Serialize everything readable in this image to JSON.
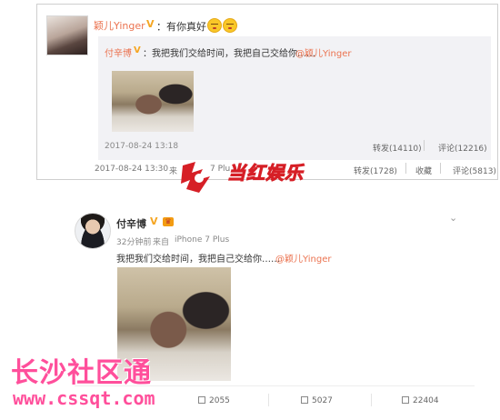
{
  "top_post": {
    "author": "颖儿Yinger",
    "verified_badge": "V",
    "text": "：有你真好",
    "emoji_icons": [
      "smiling-face-icon",
      "smiling-face-icon"
    ],
    "quoted": {
      "author": "付辛博",
      "verified_badge": "V",
      "text": "：我把我们交给时间，我把自己交给你……",
      "mention": "@颖儿Yinger",
      "date": "2017-08-24 13:18",
      "repost": "转发(14110)",
      "comment": "评论(12216)"
    },
    "date": "2017-08-24 13:30",
    "from_label": "来",
    "source": "7 Plu",
    "repost": "转发(1728)",
    "favorite": "收藏",
    "comment": "评论(5813)"
  },
  "watermark_center": {
    "text": "当红娱乐"
  },
  "bottom_post": {
    "author": "付辛博",
    "verified_badge": "V",
    "time": "32分钟前",
    "from_label": "来自",
    "source": "iPhone 7 Plus",
    "text": "我把我们交给时间，我把自己交给你……",
    "mention": "@颖儿Yinger",
    "repost_count": "2055",
    "comment_count": "5027",
    "like_count": "22404",
    "menu_icon": "chevron-down-icon"
  },
  "watermark_bottom": {
    "chinese": "长沙社区通",
    "url": "www.cssqt.com"
  },
  "colors": {
    "link_orange": "#eb7350",
    "verified_gold": "#f5a623",
    "watermark_pink": "#ff4f9b",
    "watermark_red": "#d61f26"
  }
}
